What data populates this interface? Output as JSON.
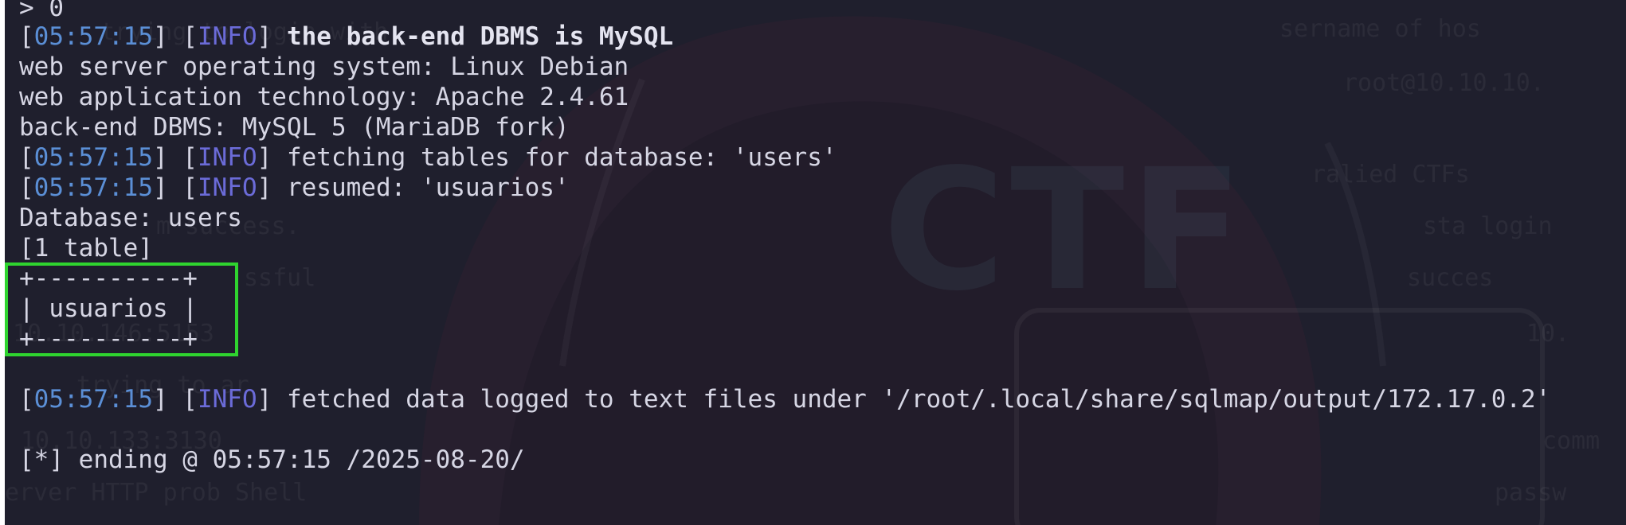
{
  "terminal": {
    "top_fragment": "> 0",
    "lines": {
      "l1": {
        "time": "05:57:15",
        "level": "INFO",
        "message": "the back-end DBMS is MySQL"
      },
      "l2": "web server operating system: Linux Debian",
      "l3": "web application technology: Apache 2.4.61",
      "l4": "back-end DBMS: MySQL 5 (MariaDB fork)",
      "l5": {
        "time": "05:57:15",
        "level": "INFO",
        "message": "fetching tables for database: 'users'"
      },
      "l6": {
        "time": "05:57:15",
        "level": "INFO",
        "message": "resumed: 'usuarios'"
      },
      "l7": "Database: users",
      "l8": "[1 table]",
      "table_border_top": "+----------+",
      "table_row": "| usuarios |",
      "table_border_bottom": "+----------+",
      "l12": {
        "time": "05:57:15",
        "level": "INFO",
        "message": "fetched data logged to text files under '/root/.local/share/sqlmap/output/172.17.0.2'"
      },
      "l13": "[*] ending @ 05:57:15 /2025-08-20/"
    }
  },
  "wallpaper": {
    "logo_text": "CTF",
    "ghost_lines": [
      "trying to login with",
      "sername of hos",
      "root@10.10.10.",
      "ralied CTFs",
      "m success.",
      "sta login",
      "ssful",
      "succes",
      "10.10.146:5153",
      "10.",
      "trying to ar",
      "10.10.133:3130",
      "comm",
      "erver HTTP prob Shell",
      "passw"
    ]
  },
  "colors": {
    "background": "#1f1f2d",
    "text": "#d6d6e4",
    "timestamp": "#5b8fd6",
    "info": "#6b6bd8",
    "highlight": "#2fd42f"
  }
}
